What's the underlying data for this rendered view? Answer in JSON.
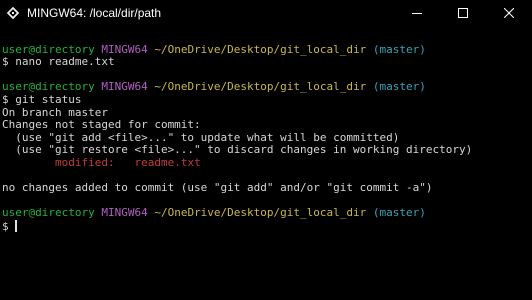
{
  "window": {
    "title": "MINGW64:  /local/dir/path",
    "icon": "mingw-app-icon",
    "controls": [
      "minimize",
      "maximize",
      "close"
    ]
  },
  "prompt": {
    "user": "user@directory",
    "system": "MINGW64",
    "path": "~/OneDrive/Desktop/git_local_dir",
    "branch": "(master)",
    "symbol": "$"
  },
  "commands": {
    "cmd1": "nano readme.txt",
    "cmd2": "git status"
  },
  "output": {
    "on_branch": "On branch master",
    "not_staged": "Changes not staged for commit:",
    "hint_add": "  (use \"git add <file>...\" to update what will be committed)",
    "hint_restore": "  (use \"git restore <file>...\" to discard changes in working directory)",
    "modified_label": "modified:",
    "modified_file": "readme.txt",
    "no_changes": "no changes added to commit (use \"git add\" and/or \"git commit -a\")"
  },
  "colors": {
    "background": "#000000",
    "text": "#d6d6d6",
    "user": "#21b23e",
    "system": "#b15fc0",
    "path": "#c9b84a",
    "branch": "#3aa3b7",
    "modified": "#c23b3b"
  }
}
